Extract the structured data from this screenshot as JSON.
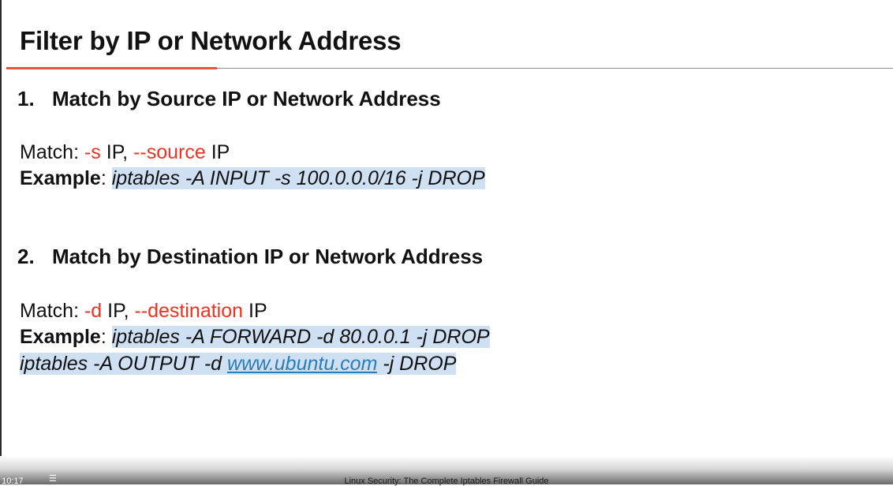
{
  "slide": {
    "title": "Filter by IP or Network Address",
    "section1": {
      "number": "1.",
      "heading": "Match by Source IP or Network Address",
      "match_label": "Match: ",
      "opt1": "-s",
      "opt1_arg": " IP,  ",
      "opt2": "--source",
      "opt2_arg": " IP",
      "example_label": "Example",
      "example_sep": ": ",
      "example_cmd": "iptables -A INPUT -s 100.0.0.0/16 -j DROP"
    },
    "section2": {
      "number": "2.",
      "heading": "Match by Destination IP or Network Address",
      "match_label": "Match: ",
      "opt1": "-d",
      "opt1_arg": " IP, ",
      "opt2": "--destination",
      "opt2_arg": " IP",
      "example_label": "Example",
      "example_sep": ": ",
      "example_cmd1": "iptables -A FORWARD -d 80.0.0.1 -j DROP",
      "example_cmd2_prefix": "iptables -A OUTPUT -d ",
      "example_cmd2_link": "www.ubuntu.com",
      "example_cmd2_suffix": " -j DROP"
    }
  },
  "player": {
    "time": "/ 10:17",
    "chapters_icon": "chapters-list-icon",
    "video_title": "Linux Security: The Complete Iptables Firewall Guide"
  },
  "colors": {
    "accent_red": "#ea3323",
    "rule_red": "#e8533f",
    "highlight": "#cfe0f3",
    "link": "#2a7db8"
  }
}
